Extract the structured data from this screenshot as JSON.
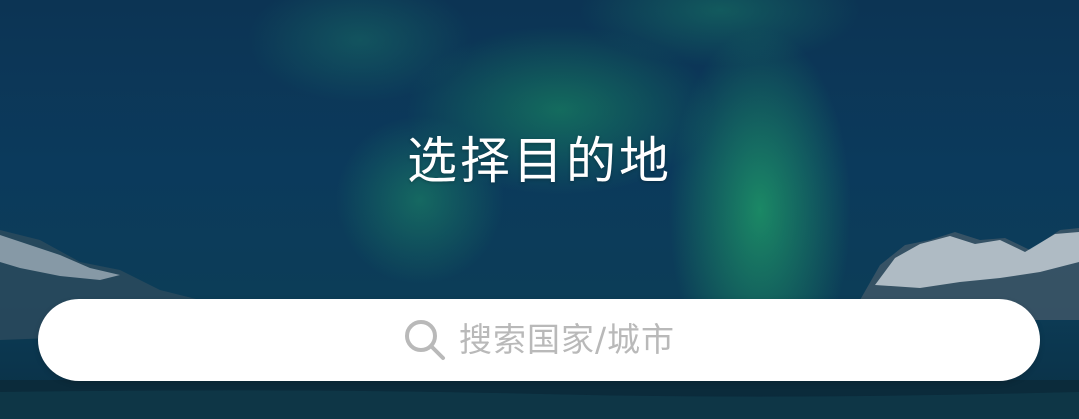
{
  "page": {
    "title": "选择目的地"
  },
  "search": {
    "placeholder": "搜索国家/城市",
    "icon": "search-icon"
  },
  "colors": {
    "title_text": "#ffffff",
    "search_bg": "#ffffff",
    "placeholder_text": "#b9b9b9",
    "aurora": "#2ec873",
    "sky": "#0b3a5c"
  }
}
